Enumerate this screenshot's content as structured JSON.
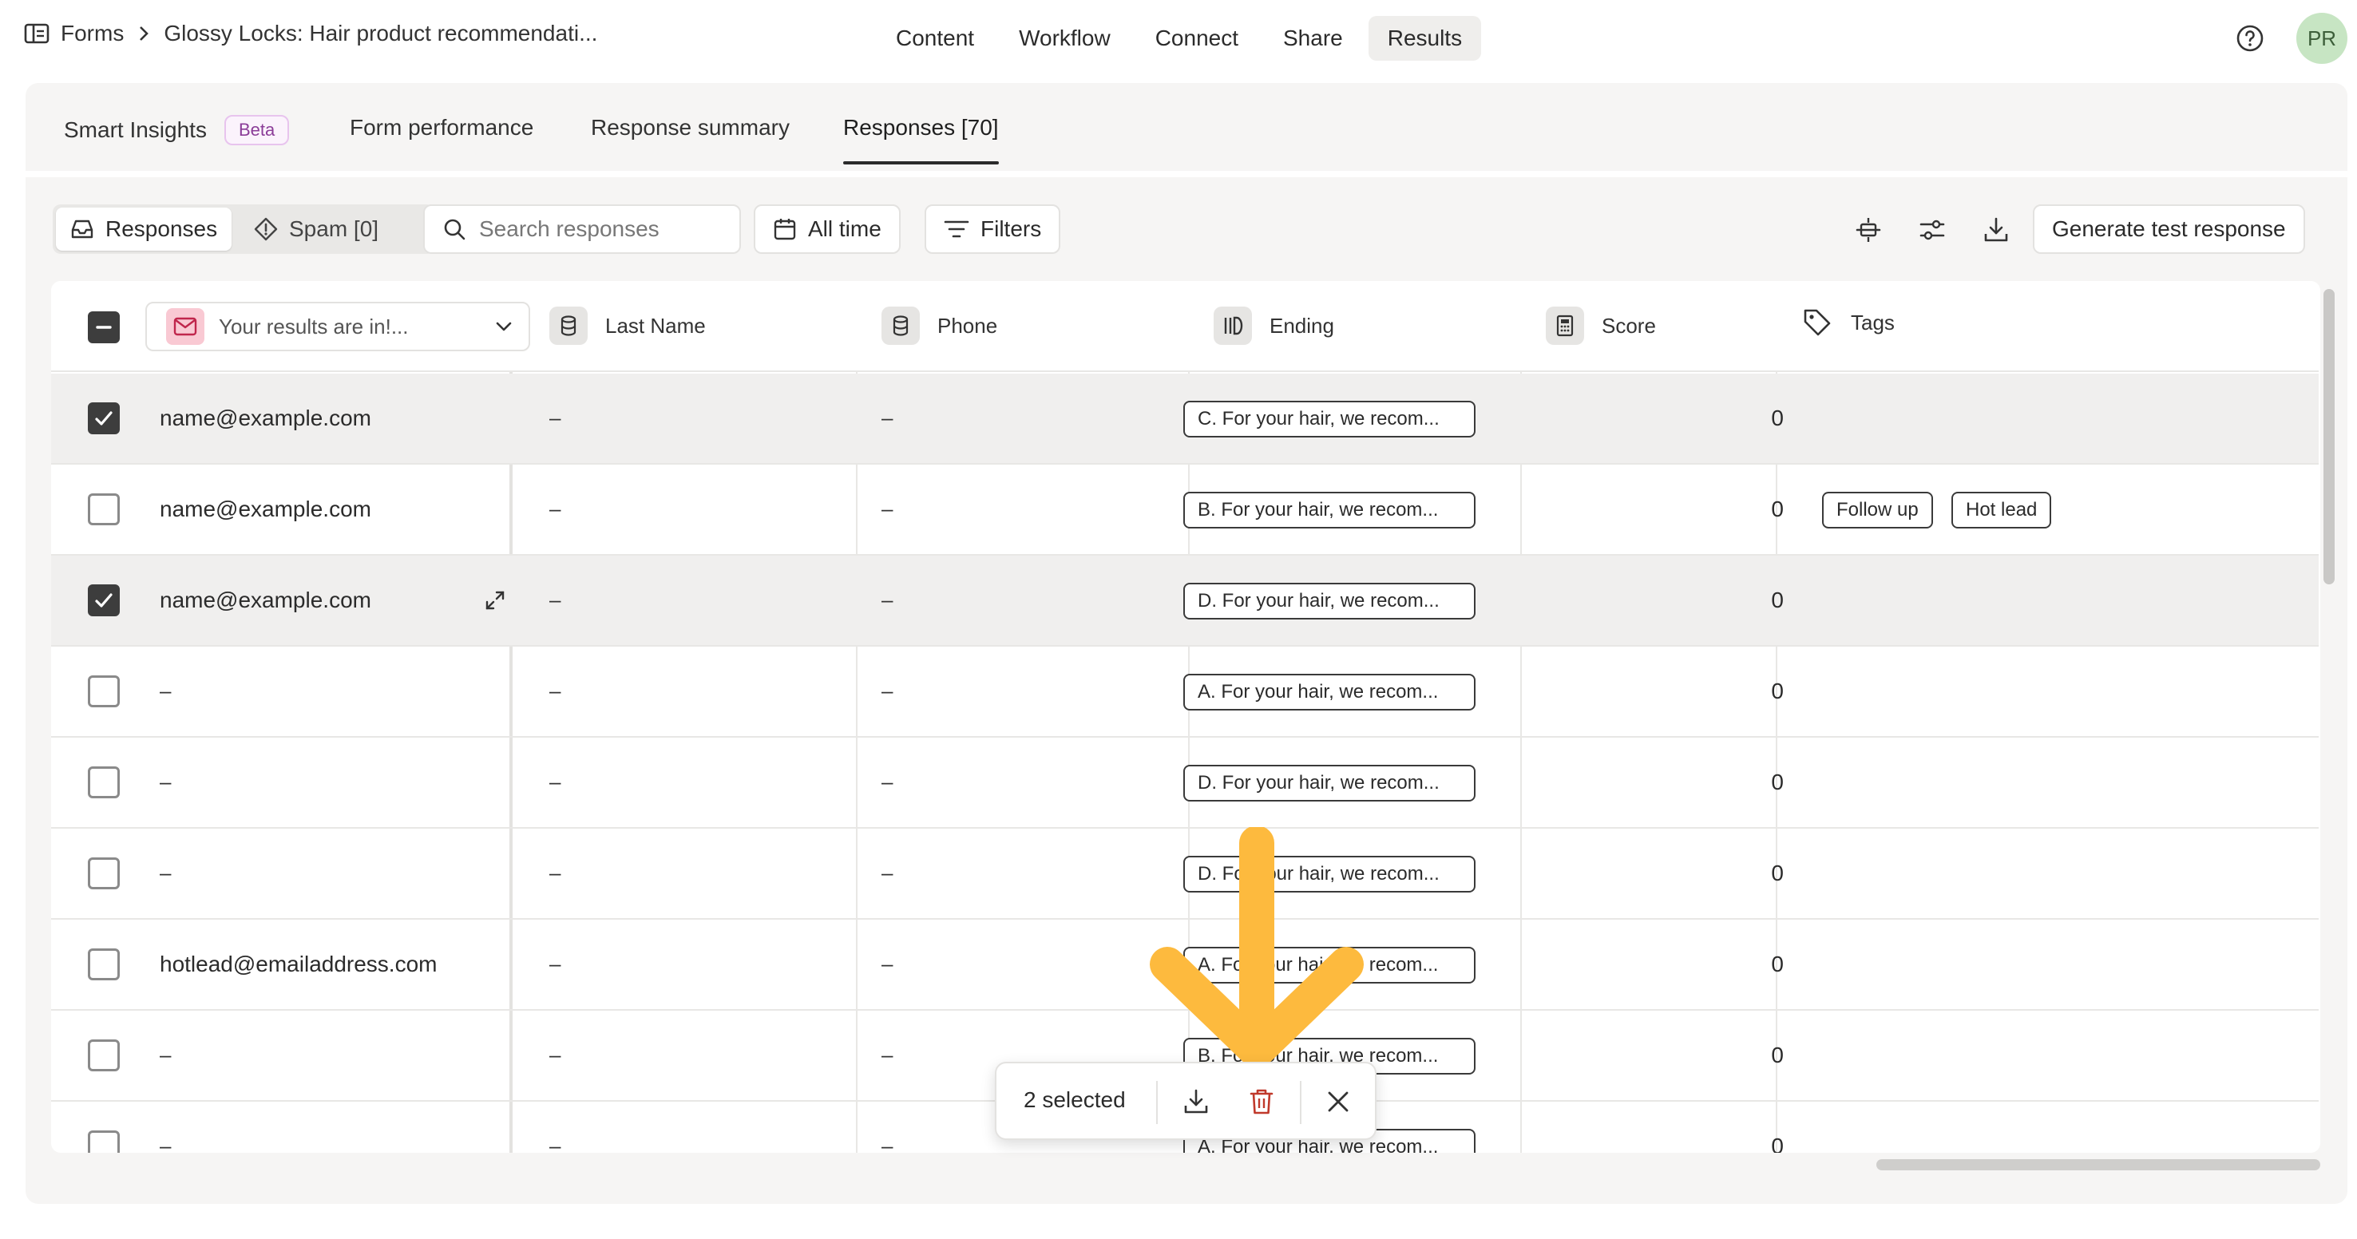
{
  "breadcrumb": {
    "root": "Forms",
    "current": "Glossy Locks: Hair product recommendati..."
  },
  "topnav": [
    "Content",
    "Workflow",
    "Connect",
    "Share",
    "Results"
  ],
  "topnav_active": "Results",
  "avatar": "PR",
  "subtabs": {
    "smart_insights": "Smart Insights",
    "beta": "Beta",
    "form_performance": "Form performance",
    "response_summary": "Response summary",
    "responses": "Responses [70]"
  },
  "toolbar": {
    "responses": "Responses",
    "spam": "Spam [0]",
    "search_placeholder": "Search responses",
    "all_time": "All time",
    "filters": "Filters",
    "generate": "Generate test response"
  },
  "columns": {
    "email_select": "Your results are in!...",
    "last_name": "Last Name",
    "phone": "Phone",
    "ending": "Ending",
    "score": "Score",
    "tags": "Tags"
  },
  "rows": [
    {
      "checked": true,
      "email": "name@example.com",
      "last_name": "–",
      "phone": "–",
      "ending": "C. For your hair, we recom...",
      "score": "0",
      "tags": []
    },
    {
      "checked": false,
      "email": "name@example.com",
      "last_name": "–",
      "phone": "–",
      "ending": "B. For your hair, we recom...",
      "score": "0",
      "tags": [
        "Follow up",
        "Hot lead"
      ]
    },
    {
      "checked": true,
      "email": "name@example.com",
      "last_name": "–",
      "phone": "–",
      "ending": "D. For your hair, we recom...",
      "score": "0",
      "tags": []
    },
    {
      "checked": false,
      "email": "–",
      "last_name": "–",
      "phone": "–",
      "ending": "A. For your hair, we recom...",
      "score": "0",
      "tags": []
    },
    {
      "checked": false,
      "email": "–",
      "last_name": "–",
      "phone": "–",
      "ending": "D. For your hair, we recom...",
      "score": "0",
      "tags": []
    },
    {
      "checked": false,
      "email": "–",
      "last_name": "–",
      "phone": "–",
      "ending": "D. For your hair, we recom...",
      "score": "0",
      "tags": []
    },
    {
      "checked": false,
      "email": "hotlead@emailaddress.com",
      "last_name": "–",
      "phone": "–",
      "ending": "A. For your hair, we recom...",
      "score": "0",
      "tags": []
    },
    {
      "checked": false,
      "email": "–",
      "last_name": "–",
      "phone": "–",
      "ending": "B. For your hair, we recom...",
      "score": "0",
      "tags": []
    },
    {
      "checked": false,
      "email": "–",
      "last_name": "–",
      "phone": "–",
      "ending": "A. For your hair, we recom...",
      "score": "0",
      "tags": []
    }
  ],
  "selection": {
    "count_label": "2 selected"
  },
  "colors": {
    "annotation_arrow": "#FDBA3E",
    "delete_icon": "#C0392B",
    "mail_bg": "#F9C9D3",
    "beta_text": "#8B3D98",
    "avatar_bg": "#C7E5C3"
  }
}
